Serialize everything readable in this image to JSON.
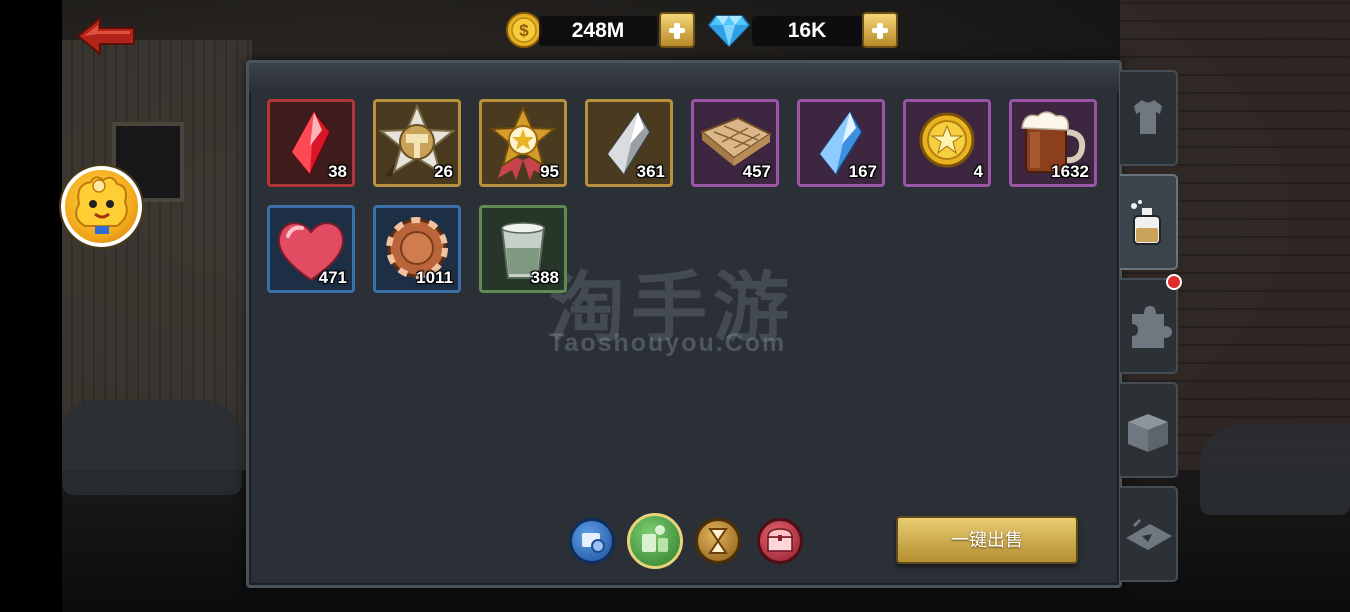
{
  "currencies": {
    "gold": {
      "amount": "248M",
      "icon": "gold-coin-icon"
    },
    "gems": {
      "amount": "16K",
      "icon": "diamond-icon"
    }
  },
  "inventory": {
    "items": [
      {
        "icon": "red-crystal-icon",
        "quantity": "38",
        "rarity": "red"
      },
      {
        "icon": "hammer-star-medal-icon",
        "quantity": "26",
        "rarity": "gold"
      },
      {
        "icon": "star-ribbon-medal-icon",
        "quantity": "95",
        "rarity": "gold"
      },
      {
        "icon": "silver-crystal-icon",
        "quantity": "361",
        "rarity": "gold"
      },
      {
        "icon": "treasure-map-icon",
        "quantity": "457",
        "rarity": "purple"
      },
      {
        "icon": "blue-crystal-icon",
        "quantity": "167",
        "rarity": "purple"
      },
      {
        "icon": "gold-star-coin-icon",
        "quantity": "4",
        "rarity": "purple"
      },
      {
        "icon": "beer-mug-icon",
        "quantity": "1632",
        "rarity": "purple"
      },
      {
        "icon": "red-heart-icon",
        "quantity": "471",
        "rarity": "blue"
      },
      {
        "icon": "bronze-chip-icon",
        "quantity": "1011",
        "rarity": "blue"
      },
      {
        "icon": "shot-glass-icon",
        "quantity": "388",
        "rarity": "green"
      }
    ]
  },
  "watermark": {
    "cn": "淘手游",
    "en": "Taoshouyou.Com"
  },
  "filters": [
    {
      "icon": "blue-gear-filter-icon"
    },
    {
      "icon": "green-consumables-filter-icon",
      "selected": true
    },
    {
      "icon": "hourglass-filter-icon"
    },
    {
      "icon": "treasure-chest-filter-icon"
    }
  ],
  "sell_all_label": "一键出售",
  "side_tabs": [
    {
      "icon": "shirt-icon"
    },
    {
      "icon": "potion-bottle-icon",
      "active": true
    },
    {
      "icon": "puzzle-piece-icon",
      "badge": true
    },
    {
      "icon": "box-icon"
    },
    {
      "icon": "ticket-icon"
    }
  ],
  "colors": {
    "panel_bg": "#2a3035",
    "rarity_red": "#b03636",
    "rarity_gold": "#b8913d",
    "rarity_purple": "#9a55a6",
    "rarity_blue": "#3c6fa7",
    "rarity_green": "#5f8a52",
    "button_gold": "#d9b75a"
  }
}
